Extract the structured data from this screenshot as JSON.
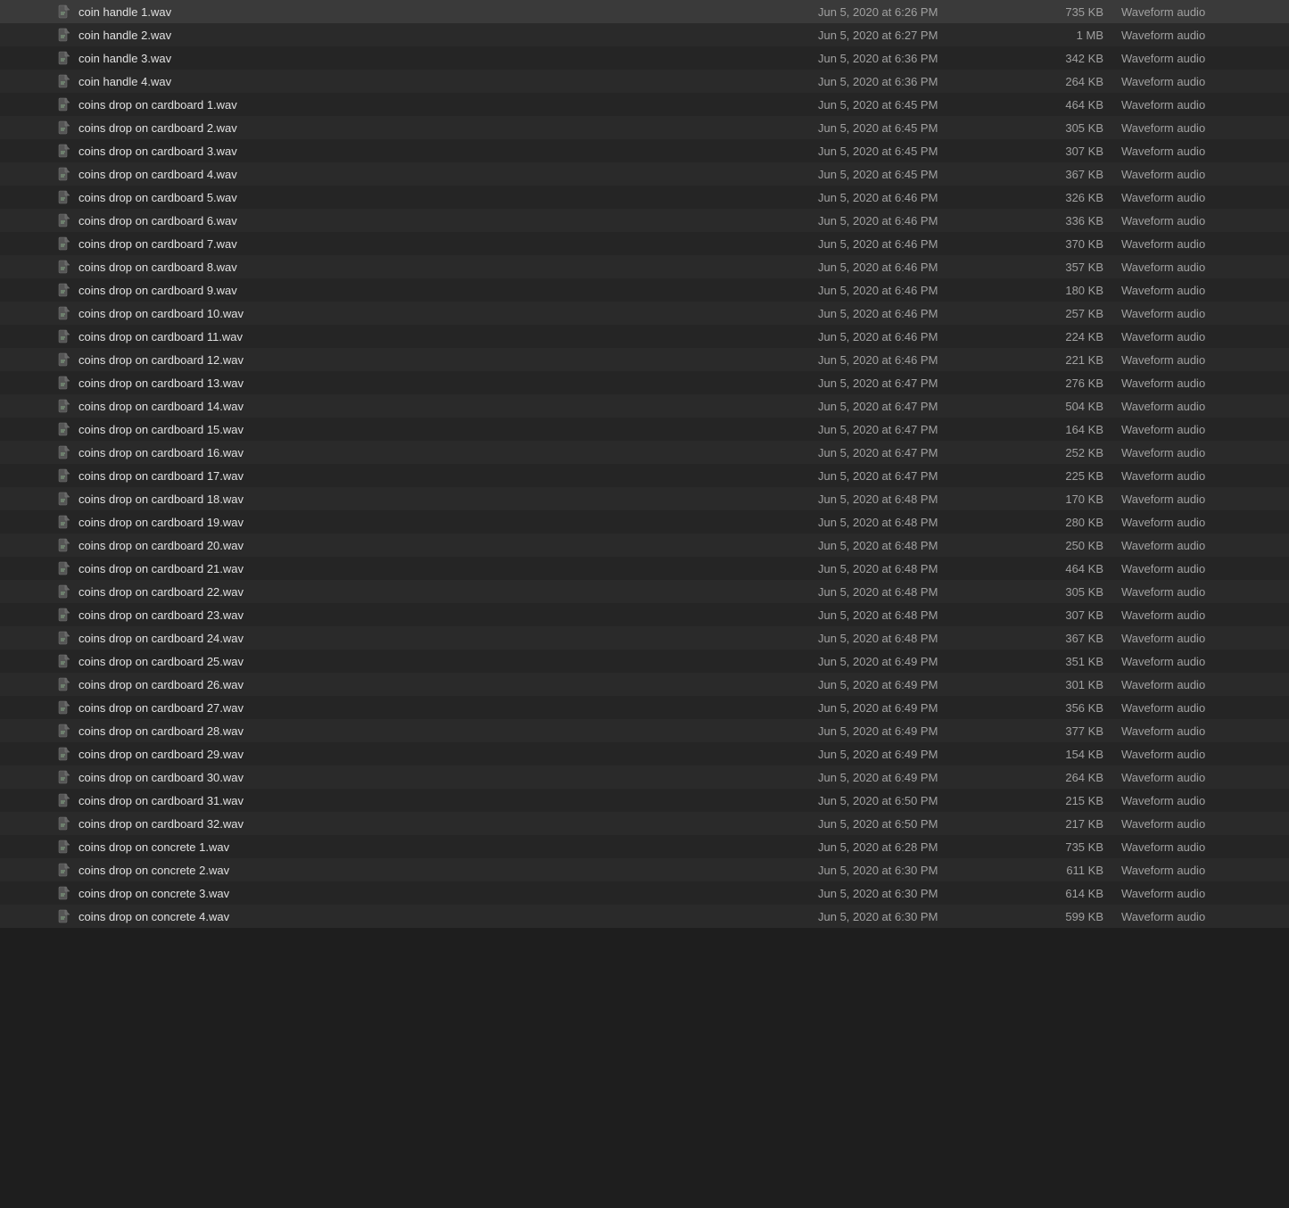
{
  "files": [
    {
      "name": "coin handle 1.wav",
      "date": "Jun 5, 2020 at 6:26 PM",
      "size": "735 KB",
      "kind": "Waveform audio"
    },
    {
      "name": "coin handle 2.wav",
      "date": "Jun 5, 2020 at 6:27 PM",
      "size": "1 MB",
      "kind": "Waveform audio"
    },
    {
      "name": "coin handle 3.wav",
      "date": "Jun 5, 2020 at 6:36 PM",
      "size": "342 KB",
      "kind": "Waveform audio"
    },
    {
      "name": "coin handle 4.wav",
      "date": "Jun 5, 2020 at 6:36 PM",
      "size": "264 KB",
      "kind": "Waveform audio"
    },
    {
      "name": "coins drop on cardboard 1.wav",
      "date": "Jun 5, 2020 at 6:45 PM",
      "size": "464 KB",
      "kind": "Waveform audio"
    },
    {
      "name": "coins drop on cardboard 2.wav",
      "date": "Jun 5, 2020 at 6:45 PM",
      "size": "305 KB",
      "kind": "Waveform audio"
    },
    {
      "name": "coins drop on cardboard 3.wav",
      "date": "Jun 5, 2020 at 6:45 PM",
      "size": "307 KB",
      "kind": "Waveform audio"
    },
    {
      "name": "coins drop on cardboard 4.wav",
      "date": "Jun 5, 2020 at 6:45 PM",
      "size": "367 KB",
      "kind": "Waveform audio"
    },
    {
      "name": "coins drop on cardboard 5.wav",
      "date": "Jun 5, 2020 at 6:46 PM",
      "size": "326 KB",
      "kind": "Waveform audio"
    },
    {
      "name": "coins drop on cardboard 6.wav",
      "date": "Jun 5, 2020 at 6:46 PM",
      "size": "336 KB",
      "kind": "Waveform audio"
    },
    {
      "name": "coins drop on cardboard 7.wav",
      "date": "Jun 5, 2020 at 6:46 PM",
      "size": "370 KB",
      "kind": "Waveform audio"
    },
    {
      "name": "coins drop on cardboard 8.wav",
      "date": "Jun 5, 2020 at 6:46 PM",
      "size": "357 KB",
      "kind": "Waveform audio"
    },
    {
      "name": "coins drop on cardboard 9.wav",
      "date": "Jun 5, 2020 at 6:46 PM",
      "size": "180 KB",
      "kind": "Waveform audio"
    },
    {
      "name": "coins drop on cardboard 10.wav",
      "date": "Jun 5, 2020 at 6:46 PM",
      "size": "257 KB",
      "kind": "Waveform audio"
    },
    {
      "name": "coins drop on cardboard 11.wav",
      "date": "Jun 5, 2020 at 6:46 PM",
      "size": "224 KB",
      "kind": "Waveform audio"
    },
    {
      "name": "coins drop on cardboard 12.wav",
      "date": "Jun 5, 2020 at 6:46 PM",
      "size": "221 KB",
      "kind": "Waveform audio"
    },
    {
      "name": "coins drop on cardboard 13.wav",
      "date": "Jun 5, 2020 at 6:47 PM",
      "size": "276 KB",
      "kind": "Waveform audio"
    },
    {
      "name": "coins drop on cardboard 14.wav",
      "date": "Jun 5, 2020 at 6:47 PM",
      "size": "504 KB",
      "kind": "Waveform audio"
    },
    {
      "name": "coins drop on cardboard 15.wav",
      "date": "Jun 5, 2020 at 6:47 PM",
      "size": "164 KB",
      "kind": "Waveform audio"
    },
    {
      "name": "coins drop on cardboard 16.wav",
      "date": "Jun 5, 2020 at 6:47 PM",
      "size": "252 KB",
      "kind": "Waveform audio"
    },
    {
      "name": "coins drop on cardboard 17.wav",
      "date": "Jun 5, 2020 at 6:47 PM",
      "size": "225 KB",
      "kind": "Waveform audio"
    },
    {
      "name": "coins drop on cardboard 18.wav",
      "date": "Jun 5, 2020 at 6:48 PM",
      "size": "170 KB",
      "kind": "Waveform audio"
    },
    {
      "name": "coins drop on cardboard 19.wav",
      "date": "Jun 5, 2020 at 6:48 PM",
      "size": "280 KB",
      "kind": "Waveform audio"
    },
    {
      "name": "coins drop on cardboard 20.wav",
      "date": "Jun 5, 2020 at 6:48 PM",
      "size": "250 KB",
      "kind": "Waveform audio"
    },
    {
      "name": "coins drop on cardboard 21.wav",
      "date": "Jun 5, 2020 at 6:48 PM",
      "size": "464 KB",
      "kind": "Waveform audio"
    },
    {
      "name": "coins drop on cardboard 22.wav",
      "date": "Jun 5, 2020 at 6:48 PM",
      "size": "305 KB",
      "kind": "Waveform audio"
    },
    {
      "name": "coins drop on cardboard 23.wav",
      "date": "Jun 5, 2020 at 6:48 PM",
      "size": "307 KB",
      "kind": "Waveform audio"
    },
    {
      "name": "coins drop on cardboard 24.wav",
      "date": "Jun 5, 2020 at 6:48 PM",
      "size": "367 KB",
      "kind": "Waveform audio"
    },
    {
      "name": "coins drop on cardboard 25.wav",
      "date": "Jun 5, 2020 at 6:49 PM",
      "size": "351 KB",
      "kind": "Waveform audio"
    },
    {
      "name": "coins drop on cardboard 26.wav",
      "date": "Jun 5, 2020 at 6:49 PM",
      "size": "301 KB",
      "kind": "Waveform audio"
    },
    {
      "name": "coins drop on cardboard 27.wav",
      "date": "Jun 5, 2020 at 6:49 PM",
      "size": "356 KB",
      "kind": "Waveform audio"
    },
    {
      "name": "coins drop on cardboard 28.wav",
      "date": "Jun 5, 2020 at 6:49 PM",
      "size": "377 KB",
      "kind": "Waveform audio"
    },
    {
      "name": "coins drop on cardboard 29.wav",
      "date": "Jun 5, 2020 at 6:49 PM",
      "size": "154 KB",
      "kind": "Waveform audio"
    },
    {
      "name": "coins drop on cardboard 30.wav",
      "date": "Jun 5, 2020 at 6:49 PM",
      "size": "264 KB",
      "kind": "Waveform audio"
    },
    {
      "name": "coins drop on cardboard 31.wav",
      "date": "Jun 5, 2020 at 6:50 PM",
      "size": "215 KB",
      "kind": "Waveform audio"
    },
    {
      "name": "coins drop on cardboard 32.wav",
      "date": "Jun 5, 2020 at 6:50 PM",
      "size": "217 KB",
      "kind": "Waveform audio"
    },
    {
      "name": "coins drop on concrete 1.wav",
      "date": "Jun 5, 2020 at 6:28 PM",
      "size": "735 KB",
      "kind": "Waveform audio"
    },
    {
      "name": "coins drop on concrete 2.wav",
      "date": "Jun 5, 2020 at 6:30 PM",
      "size": "611 KB",
      "kind": "Waveform audio"
    },
    {
      "name": "coins drop on concrete 3.wav",
      "date": "Jun 5, 2020 at 6:30 PM",
      "size": "614 KB",
      "kind": "Waveform audio"
    },
    {
      "name": "coins drop on concrete 4.wav",
      "date": "Jun 5, 2020 at 6:30 PM",
      "size": "599 KB",
      "kind": "Waveform audio"
    }
  ]
}
